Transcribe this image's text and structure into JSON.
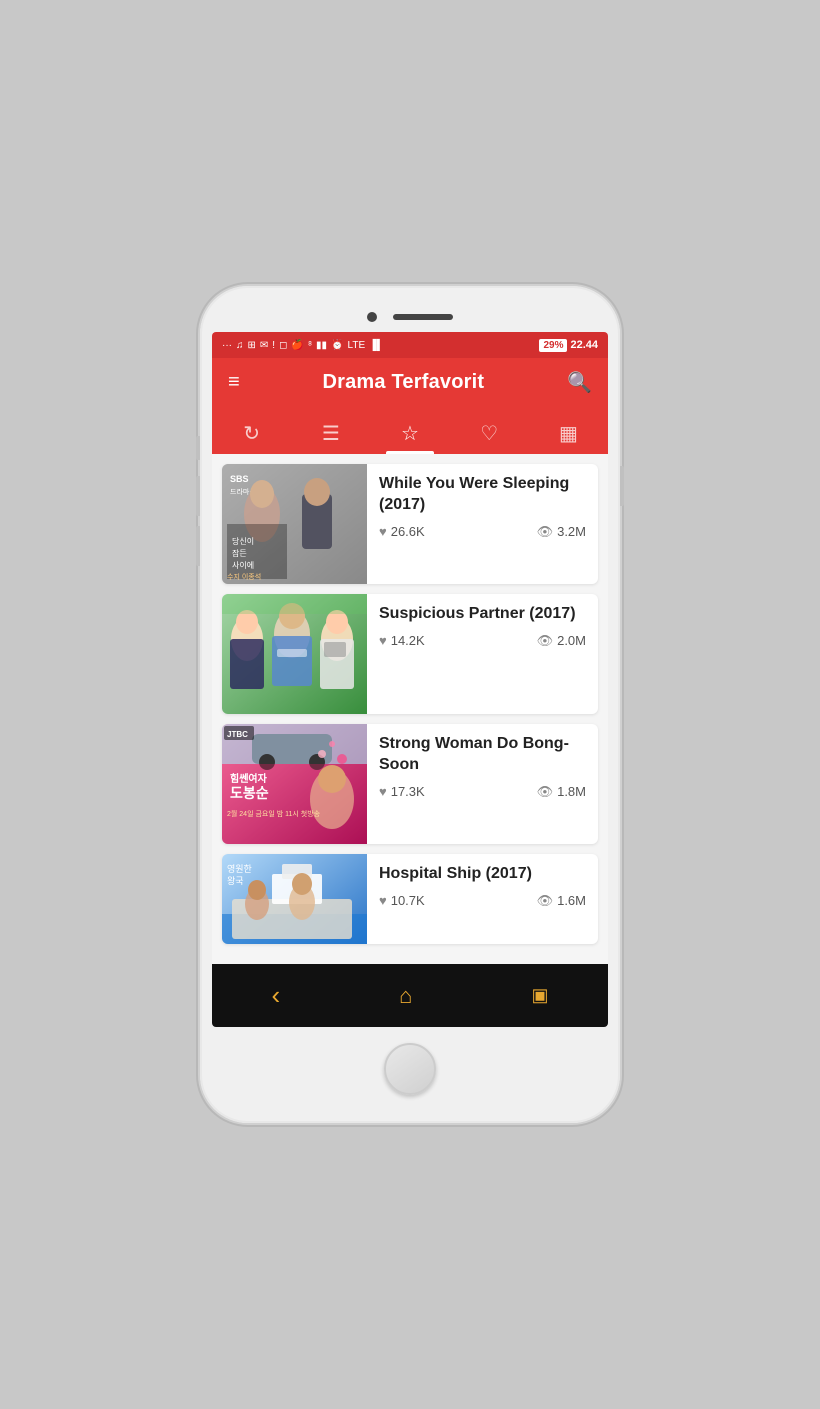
{
  "statusBar": {
    "icons": [
      "...",
      "♫",
      "✉",
      "✉",
      "!",
      "◻",
      "❋",
      "⊠",
      "⏰",
      "LTE"
    ],
    "battery": "29%",
    "time": "22.44"
  },
  "header": {
    "title": "Drama Terfavorit",
    "hamburger": "≡",
    "search": "🔍"
  },
  "tabs": [
    {
      "id": "refresh",
      "icon": "↻",
      "active": false
    },
    {
      "id": "list",
      "icon": "≡",
      "active": false
    },
    {
      "id": "star",
      "icon": "☆",
      "active": true
    },
    {
      "id": "heart",
      "icon": "♡",
      "active": false
    },
    {
      "id": "gallery",
      "icon": "▦",
      "active": false
    }
  ],
  "dramas": [
    {
      "id": 1,
      "title": "While You Were Sleeping (2017)",
      "likes": "26.6K",
      "views": "3.2M",
      "posterBg": "#9e9e9e"
    },
    {
      "id": 2,
      "title": "Suspicious Partner (2017)",
      "likes": "14.2K",
      "views": "2.0M",
      "posterBg": "#66bb6a"
    },
    {
      "id": 3,
      "title": "Strong Woman Do Bong-Soon",
      "likes": "17.3K",
      "views": "1.8M",
      "posterBg": "#ec407a"
    },
    {
      "id": 4,
      "title": "Hospital Ship (2017)",
      "likes": "10.7K",
      "views": "1.6M",
      "posterBg": "#42a5f5"
    }
  ],
  "bottomNav": {
    "back": "‹",
    "home": "⌂",
    "square": "▣"
  }
}
